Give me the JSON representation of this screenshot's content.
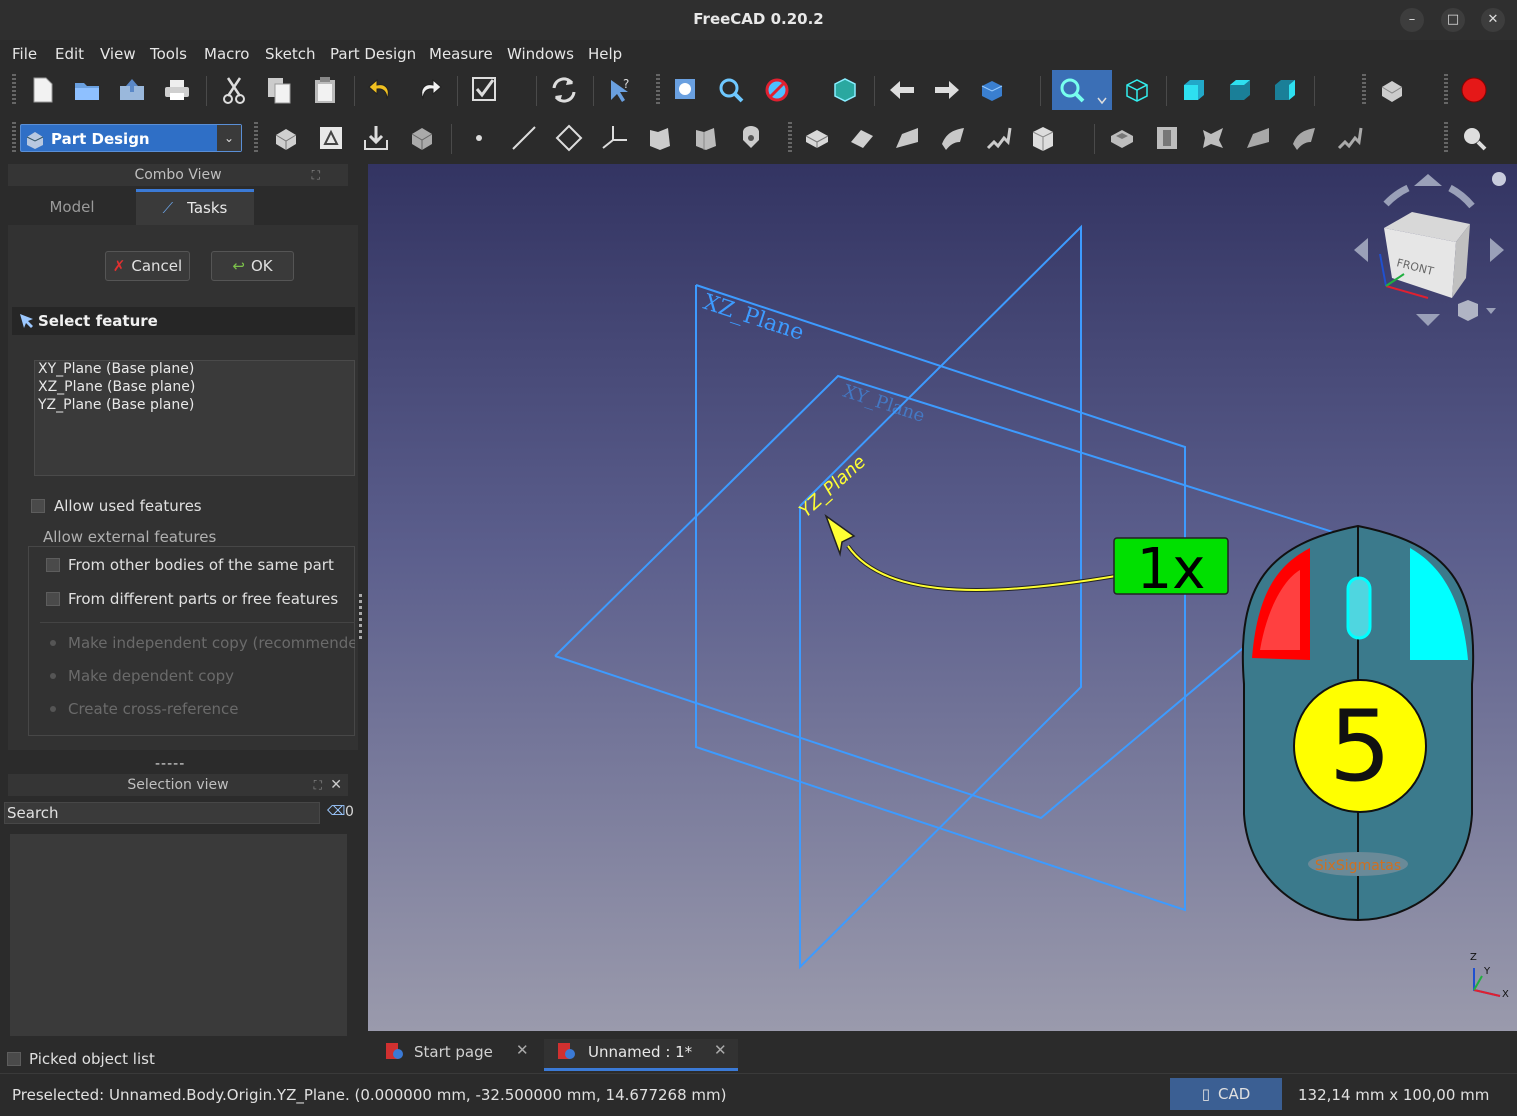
{
  "window": {
    "title": "FreeCAD 0.20.2"
  },
  "menu": [
    "File",
    "Edit",
    "View",
    "Tools",
    "Macro",
    "Sketch",
    "Part Design",
    "Measure",
    "Windows",
    "Help"
  ],
  "workbench": {
    "selected": "Part Design"
  },
  "combo_view": {
    "title": "Combo View",
    "tabs": [
      {
        "label": "Model"
      },
      {
        "label": "Tasks"
      }
    ],
    "active_tab": "Tasks"
  },
  "task": {
    "cancel_label": "Cancel",
    "ok_label": "OK",
    "section_title": "Select feature",
    "features": [
      "XY_Plane (Base plane)",
      "XZ_Plane (Base plane)",
      "YZ_Plane (Base plane)"
    ],
    "allow_used": "Allow used features",
    "external_group": "Allow external features",
    "from_other_bodies": "From other bodies of the same part",
    "from_different_parts": "From different parts or free features",
    "radio_independent": "Make independent copy (recommended)",
    "radio_dependent": "Make dependent copy",
    "radio_cross": "Create cross-reference"
  },
  "splitter_label": "-----",
  "selection_view": {
    "title": "Selection view",
    "search_placeholder": "Search",
    "count": "0",
    "picked_list": "Picked object list"
  },
  "viewport": {
    "plane_labels": {
      "xz": "XZ_Plane",
      "xy": "XY_Plane",
      "yz": "YZ_Plane"
    },
    "navcube_face": "FRONT",
    "click_count": "1x",
    "mouse_step": "5",
    "mouse_brand": "SixSigmatas",
    "axis_labels": {
      "z": "Z",
      "y": "Y",
      "x": "X"
    },
    "colors": {
      "plane": "#3d9bff",
      "yz_label": "#ffff33",
      "badge": "#00e000",
      "left_button": "#ff0000",
      "right_button": "#00ffff",
      "step_circle": "#ffff00"
    }
  },
  "doc_tabs": [
    {
      "label": "Start page"
    },
    {
      "label": "Unnamed : 1*"
    }
  ],
  "status": {
    "message": "Preselected: Unnamed.Body.Origin.YZ_Plane. (0.000000 mm, -32.500000 mm, 14.677268 mm)",
    "nav_style": "CAD",
    "dimensions": "132,14 mm x 100,00 mm"
  },
  "toolbar_icons_row1": [
    "new-file-icon",
    "open-file-icon",
    "open-recent-icon",
    "print-icon",
    "cut-icon",
    "copy-icon",
    "paste-icon",
    "undo-icon",
    "redo-icon",
    "refresh-check-icon",
    "recompute-icon",
    "whats-this-icon",
    "fit-all-icon",
    "fit-selection-icon",
    "draw-style-icon",
    "bounding-box-icon",
    "back-icon",
    "forward-icon",
    "workbench-view-icon",
    "standard-views-icon",
    "isometric-icon",
    "front-view-icon",
    "top-view-icon",
    "right-view-icon",
    "part-icon",
    "macro-record-icon"
  ],
  "toolbar_icons_row2": [
    "body-icon",
    "sketch-icon",
    "validate-sketch-icon",
    "clone-icon",
    "datum-point-icon",
    "datum-line-icon",
    "datum-plane-icon",
    "local-cs-icon",
    "shape-binder-icon",
    "subshape-binder-icon",
    "part-clone-icon",
    "pad-icon",
    "revolution-icon",
    "loft-icon",
    "pipe-icon",
    "helix-icon",
    "additive-primitive-icon",
    "pocket-icon",
    "hole-icon",
    "groove-icon",
    "subtractive-loft-icon",
    "subtractive-pipe-icon",
    "measure-icon"
  ]
}
